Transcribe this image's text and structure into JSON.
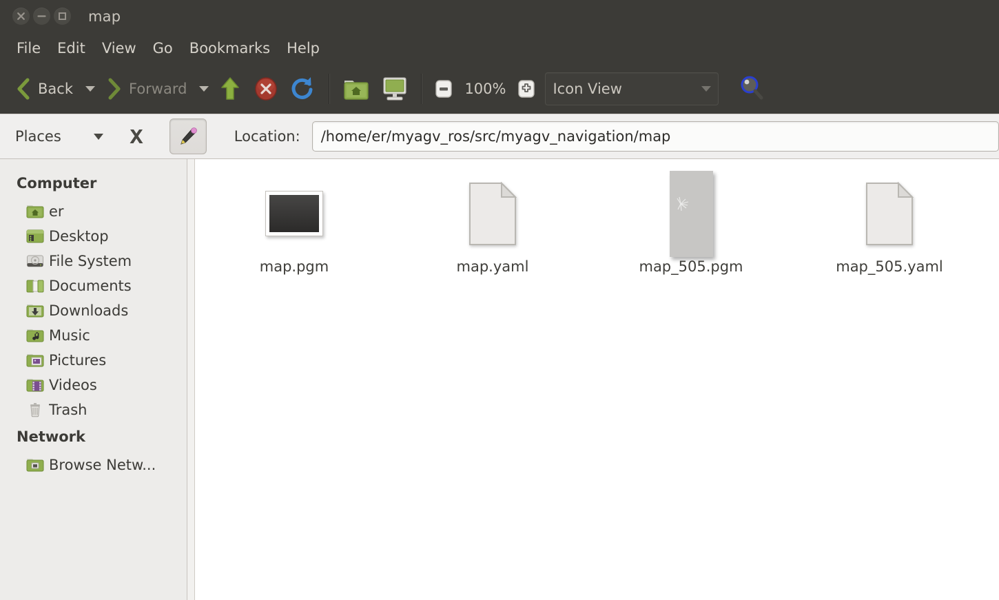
{
  "window": {
    "title": "map",
    "controls": [
      {
        "name": "close",
        "glyph": "×"
      },
      {
        "name": "minimize",
        "glyph": "−"
      },
      {
        "name": "maximize",
        "glyph": "□"
      }
    ]
  },
  "menubar": {
    "items": [
      {
        "label": "File"
      },
      {
        "label": "Edit"
      },
      {
        "label": "View"
      },
      {
        "label": "Go"
      },
      {
        "label": "Bookmarks"
      },
      {
        "label": "Help"
      }
    ]
  },
  "toolbar": {
    "back_label": "Back",
    "forward_label": "Forward",
    "up_tooltip": "Up",
    "stop_tooltip": "Stop",
    "reload_tooltip": "Reload",
    "home_tooltip": "Home",
    "computer_tooltip": "Computer",
    "zoom_out_label": "−",
    "zoom_level": "100%",
    "zoom_in_label": "+",
    "view_mode": "Icon View",
    "search_tooltip": "Search"
  },
  "locationbar": {
    "places_label": "Places",
    "close_pane_tooltip": "Close",
    "edit_location_tooltip": "Toggle location entry",
    "location_label": "Location:",
    "path": "/home/er/myagv_ros/src/myagv_navigation/map"
  },
  "sidebar": {
    "sections": [
      {
        "heading": "Computer",
        "items": [
          {
            "label": "er",
            "icon": "home-folder-icon"
          },
          {
            "label": "Desktop",
            "icon": "desktop-folder-icon"
          },
          {
            "label": "File System",
            "icon": "harddisk-icon"
          },
          {
            "label": "Documents",
            "icon": "documents-folder-icon"
          },
          {
            "label": "Downloads",
            "icon": "downloads-folder-icon"
          },
          {
            "label": "Music",
            "icon": "music-folder-icon"
          },
          {
            "label": "Pictures",
            "icon": "pictures-folder-icon"
          },
          {
            "label": "Videos",
            "icon": "videos-folder-icon"
          },
          {
            "label": "Trash",
            "icon": "trash-icon"
          }
        ]
      },
      {
        "heading": "Network",
        "items": [
          {
            "label": "Browse Netw...",
            "icon": "network-folder-icon"
          }
        ]
      }
    ]
  },
  "files": [
    {
      "name": "map.pgm",
      "thumb": "image-dark-thumbnail"
    },
    {
      "name": "map.yaml",
      "thumb": "text-document-icon"
    },
    {
      "name": "map_505.pgm",
      "thumb": "image-light-portrait-thumbnail"
    },
    {
      "name": "map_505.yaml",
      "thumb": "text-document-icon"
    }
  ],
  "colors": {
    "titlebar": "#3c3b37",
    "toolbar": "#3c3b37",
    "toolbar_text": "#d0ccc4",
    "locationbar": "#f0efee",
    "sidebar": "#edecea",
    "fileview": "#ffffff",
    "folder_green": "#8aa84b",
    "stop_red": "#a63d32",
    "reload_blue": "#4a90d9",
    "text_dark": "#3c3b37"
  }
}
